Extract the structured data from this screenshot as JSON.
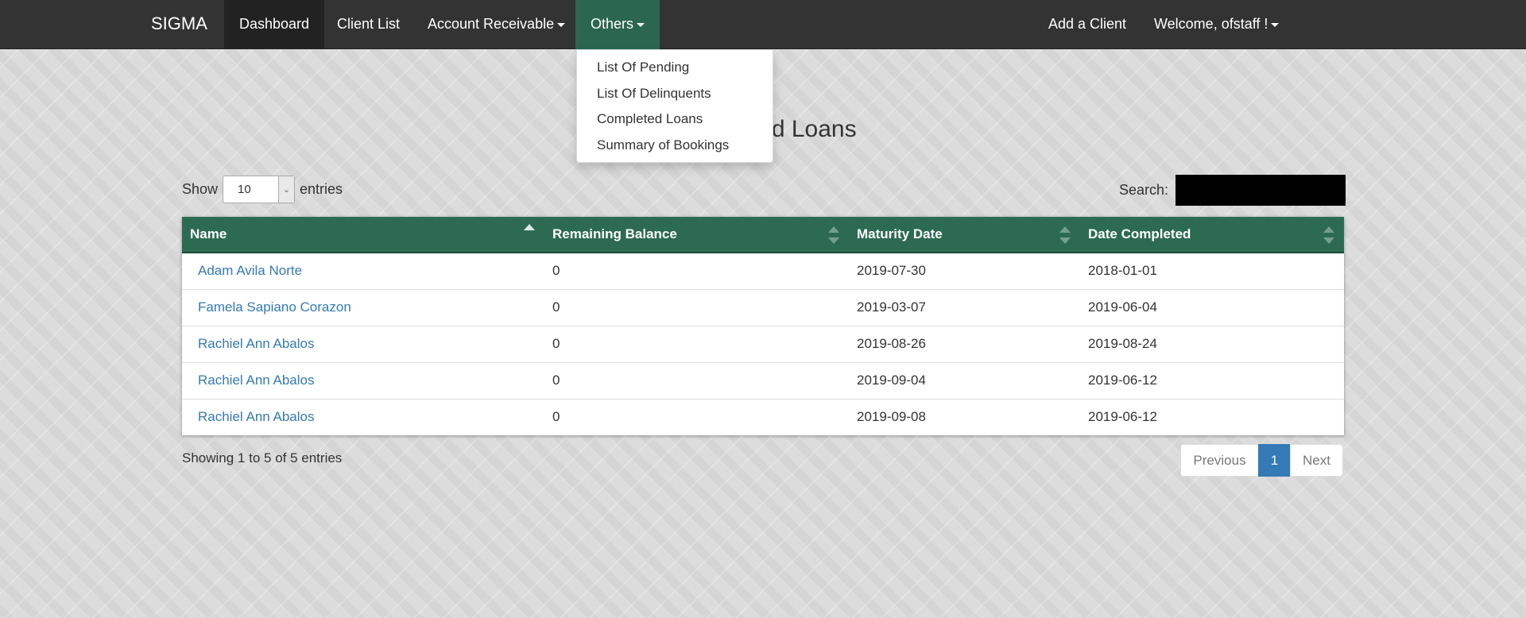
{
  "navbar": {
    "brand": "SIGMA",
    "items": [
      {
        "label": "Dashboard"
      },
      {
        "label": "Client List"
      },
      {
        "label": "Account Receivable"
      },
      {
        "label": "Others"
      }
    ],
    "right": {
      "add_client": "Add a Client",
      "welcome": "Welcome, ofstaff !"
    }
  },
  "dropdown": {
    "items": [
      "List Of Pending",
      "List Of Delinquents",
      "Completed Loans",
      "Summary of Bookings"
    ]
  },
  "page": {
    "title": "Completed Loans"
  },
  "controls": {
    "show_label": "Show",
    "entries_value": "10",
    "entries_label": "entries",
    "search_label": "Search:",
    "search_value": ""
  },
  "table": {
    "columns": [
      "Name",
      "Remaining Balance",
      "Maturity Date",
      "Date Completed"
    ],
    "sorted_column": "Name",
    "sort_direction": "asc",
    "rows": [
      {
        "name": "Adam Avila Norte",
        "balance": "0",
        "maturity": "2019-07-30",
        "completed": "2018-01-01"
      },
      {
        "name": "Famela Sapiano Corazon",
        "balance": "0",
        "maturity": "2019-03-07",
        "completed": "2019-06-04"
      },
      {
        "name": "Rachiel Ann Abalos",
        "balance": "0",
        "maturity": "2019-08-26",
        "completed": "2019-08-24"
      },
      {
        "name": "Rachiel Ann Abalos",
        "balance": "0",
        "maturity": "2019-09-04",
        "completed": "2019-06-12"
      },
      {
        "name": "Rachiel Ann Abalos",
        "balance": "0",
        "maturity": "2019-09-08",
        "completed": "2019-06-12"
      }
    ]
  },
  "footer": {
    "info": "Showing 1 to 5 of 5 entries",
    "previous": "Previous",
    "current_page": "1",
    "next": "Next"
  },
  "colors": {
    "navbar": "#333333",
    "active_nav": "#222222",
    "open_nav": "#2a6650",
    "table_header": "#2c6b52",
    "link": "#337ab7"
  }
}
